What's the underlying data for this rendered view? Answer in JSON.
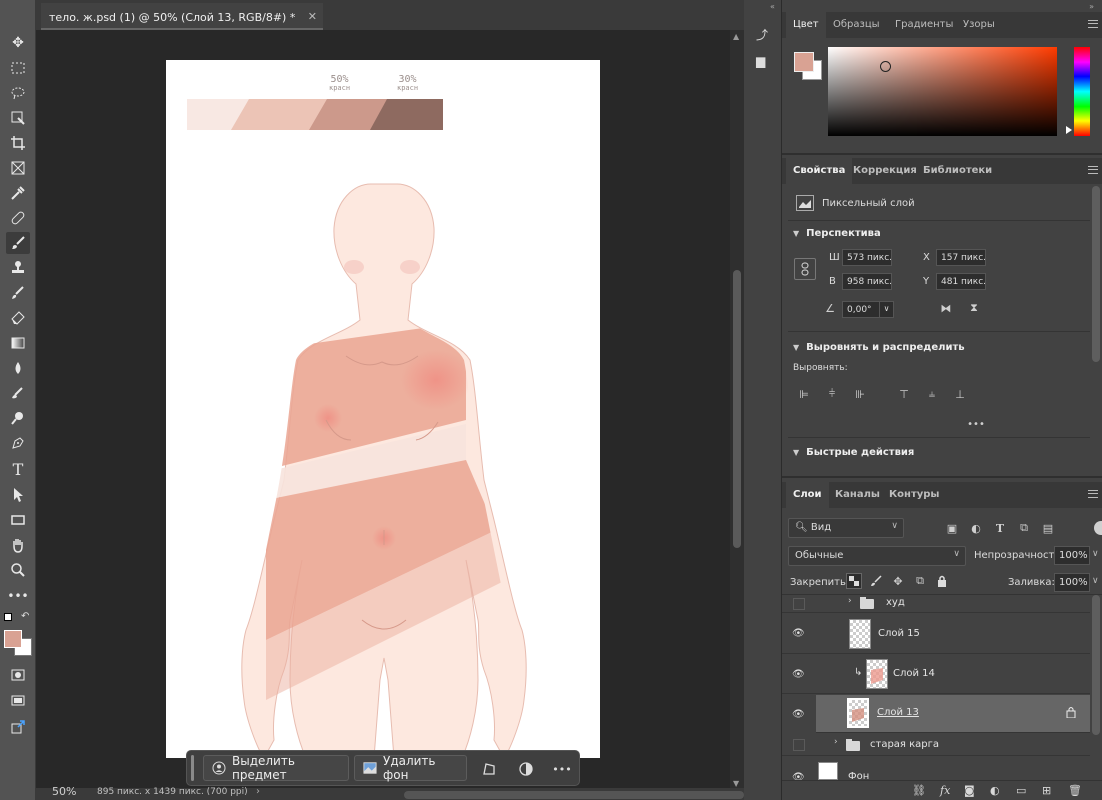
{
  "document": {
    "tab_title": "тело. ж.psd (1) @ 50% (Слой 13, RGB/8#) *",
    "zoom": "50%",
    "dimensions": "895 пикс. x 1439 пикс. (700 ppi)"
  },
  "canvas": {
    "label_left_pct": "50%",
    "label_left_word": "красн",
    "label_right_pct": "30%",
    "label_right_word": "красн",
    "palette": [
      "#f8e8e3",
      "#ecc4b6",
      "#cc998b",
      "#8e6a60"
    ]
  },
  "toolbar": {
    "tools": [
      "move-icon",
      "marquee-icon",
      "lasso-icon",
      "object-select-icon",
      "crop-icon",
      "frame-icon",
      "eyedropper-icon",
      "healing-icon",
      "brush-icon",
      "stamp-icon",
      "history-brush-icon",
      "eraser-icon",
      "gradient-icon",
      "blur-icon",
      "dodge-icon",
      "pen-icon",
      "type-icon",
      "path-select-icon",
      "rectangle-icon",
      "hand-icon",
      "zoom-icon",
      "more-icon"
    ],
    "foreground_color": "#d9a293",
    "background_color": "#ffffff"
  },
  "taskbar": {
    "select_subject": "Выделить предмет",
    "remove_bg": "Удалить фон"
  },
  "color_panel": {
    "tabs": [
      "Цвет",
      "Образцы",
      "Градиенты",
      "Узоры"
    ],
    "active": "Цвет"
  },
  "properties": {
    "tabs": [
      "Свойства",
      "Коррекция",
      "Библиотеки"
    ],
    "layer_kind": "Пиксельный слой",
    "section_transform": "Перспектива",
    "w_label": "Ш",
    "w_value": "573 пикс.",
    "h_label": "В",
    "h_value": "958 пикс.",
    "x_label": "X",
    "x_value": "157 пикс.",
    "y_label": "Y",
    "y_value": "481 пикс.",
    "angle_value": "0,00°",
    "section_align": "Выровнять и распределить",
    "align_label": "Выровнять:",
    "section_quick": "Быстрые действия"
  },
  "layers": {
    "tabs": [
      "Слои",
      "Каналы",
      "Контуры"
    ],
    "filter_label": "Вид",
    "blend_mode": "Обычные",
    "opacity_label": "Непрозрачность:",
    "opacity_value": "100%",
    "lock_label": "Закрепить:",
    "fill_label": "Заливка:",
    "fill_value": "100%",
    "items": [
      {
        "name": "худ",
        "type": "group",
        "visible": false
      },
      {
        "name": "Слой 15",
        "type": "layer",
        "visible": true
      },
      {
        "name": "Слой 14",
        "type": "layer",
        "visible": true,
        "clipped": true
      },
      {
        "name": "Слой 13",
        "type": "layer",
        "visible": true,
        "selected": true,
        "locked": true
      },
      {
        "name": "старая карга",
        "type": "group",
        "visible": false
      },
      {
        "name": "Фон",
        "type": "layer",
        "visible": true
      }
    ]
  }
}
